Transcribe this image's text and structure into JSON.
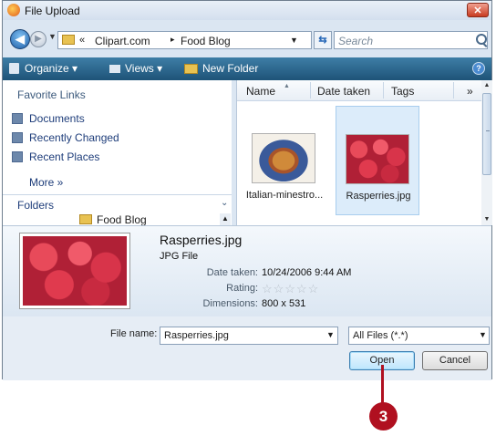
{
  "window": {
    "title": "File Upload",
    "close_label": "✕"
  },
  "address": {
    "more_glyph": "«",
    "crumbs": [
      "Clipart.com",
      "Food Blog"
    ],
    "separator": "▸",
    "search_placeholder": "Search"
  },
  "toolbar": {
    "organize": "Organize ▾",
    "views": "Views ▾",
    "new_folder": "New Folder",
    "help": "?"
  },
  "nav": {
    "favorites_heading": "Favorite Links",
    "favorites": [
      "Documents",
      "Recently Changed",
      "Recent Places"
    ],
    "more": "More »",
    "folders": "Folders",
    "folders_chevron": "⌄",
    "tree_item": "Food Blog"
  },
  "file_list": {
    "columns": [
      "Name",
      "Date taken",
      "Tags",
      "»"
    ],
    "items": [
      {
        "name": "Italian-minestro...",
        "thumbnail": "minestrone-photo",
        "selected": false
      },
      {
        "name": "Rasperries.jpg",
        "thumbnail": "raspberries-photo",
        "selected": true
      }
    ]
  },
  "details": {
    "name": "Rasperries.jpg",
    "type": "JPG File",
    "date_label": "Date taken:",
    "date_value": "10/24/2006 9:44 AM",
    "rating_label": "Rating:",
    "rating": 0,
    "rating_max": 5,
    "dimensions_label": "Dimensions:",
    "dimensions_value": "800 x 531"
  },
  "bottom": {
    "file_name_label": "File name:",
    "file_name_value": "Rasperries.jpg",
    "filter_value": "All Files (*.*)",
    "open": "Open",
    "cancel": "Cancel"
  },
  "callout": {
    "number": "3"
  },
  "colors": {
    "toolbar": "#1e5378",
    "callout": "#b01020",
    "selection": "#dcecfa"
  }
}
